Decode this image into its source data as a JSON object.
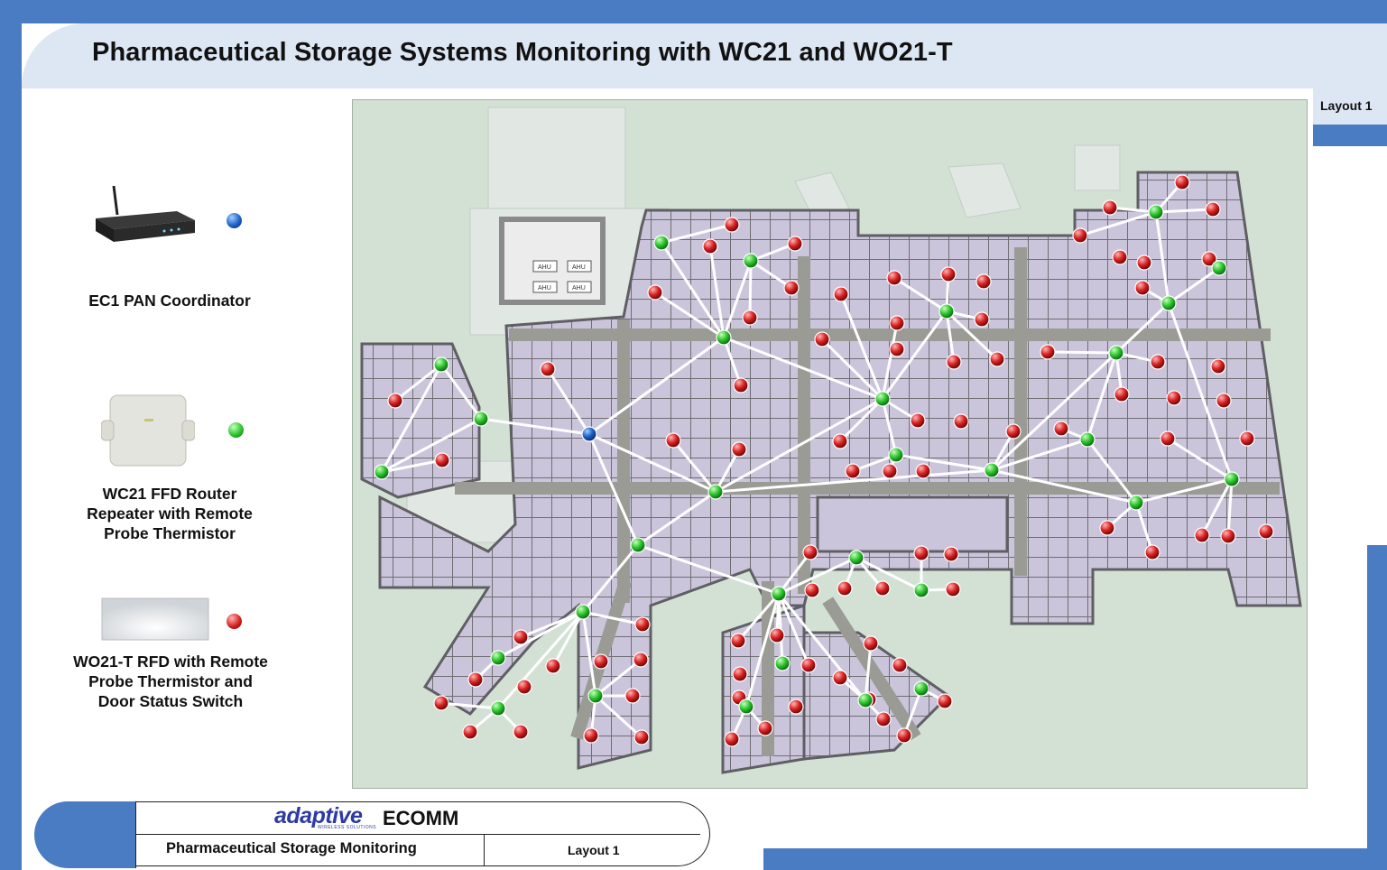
{
  "title": "Pharmaceutical Storage Systems Monitoring with WC21 and WO21-T",
  "tab_label": "Layout 1",
  "legend": [
    {
      "label": "EC1 PAN Coordinator",
      "color": "blue"
    },
    {
      "label": "WC21 FFD Router\nRepeater with Remote\nProbe Thermistor",
      "color": "green"
    },
    {
      "label": "WO21-T RFD with Remote\nProbe Thermistor and\nDoor Status Switch",
      "color": "red"
    }
  ],
  "map_labels": [
    "AHU",
    "AHU",
    "AHU",
    "AHU"
  ],
  "colors": {
    "frame": "#4a7cc4",
    "header": "#dde6f3",
    "coordinator": "#1c5fc8",
    "router": "#2bc42b",
    "end_device": "#d82020"
  },
  "footer": {
    "brand": "adaptive",
    "brand_sub": "WIRELESS SOLUTIONS",
    "product": "ECOMM",
    "subtitle": "Pharmaceutical Storage Monitoring",
    "layout": "Layout 1"
  }
}
